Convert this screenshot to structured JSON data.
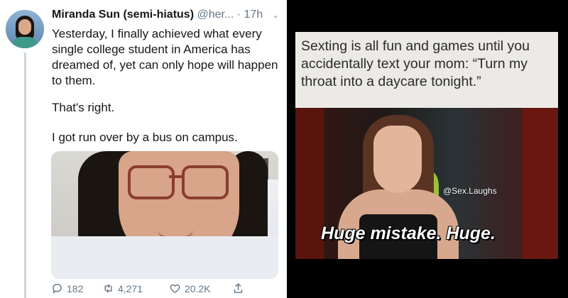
{
  "tweet": {
    "author_name": "Miranda Sun (semi-hiatus)",
    "handle": "@her...",
    "separator": " · ",
    "time": "17h",
    "paragraphs": [
      "Yesterday, I finally achieved what every single college student in America has dreamed of, yet can only hope will happen to them.",
      "That's right.",
      "I got run over by a bus on campus."
    ],
    "actions": {
      "reply_count": "182",
      "retweet_count": "4,271",
      "like_count": "20.2K"
    },
    "icons": [
      "chevron-down-icon",
      "reply-icon",
      "retweet-icon",
      "like-icon",
      "share-icon"
    ]
  },
  "meme": {
    "caption": "Sexting is all fun and games until you accidentally text your mom: “Turn my throat into a daycare tonight.”",
    "watermark": "@Sex.Laughs",
    "subtitle": "Huge mistake. Huge."
  },
  "colors": {
    "tweet_text": "#14171a",
    "tweet_secondary": "#657786",
    "thread_line": "#cdd6dd",
    "caption_bg": "#eceae6"
  }
}
